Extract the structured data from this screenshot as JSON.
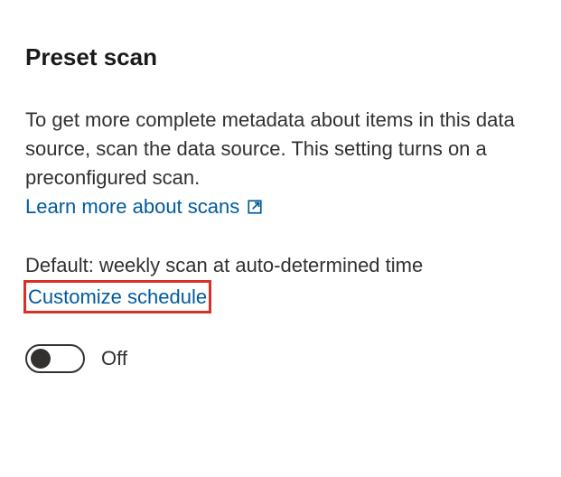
{
  "section": {
    "heading": "Preset scan",
    "description": "To get more complete metadata about items in this data source, scan the data source. This setting turns on a preconfigured scan.",
    "learn_more_label": "Learn more about scans",
    "default_prefix": "Default: weekly scan at auto-determined time",
    "customize_label": "Customize schedule",
    "toggle_state_label": "Off"
  },
  "colors": {
    "link": "#005a9e",
    "highlight_border": "#d93025"
  }
}
